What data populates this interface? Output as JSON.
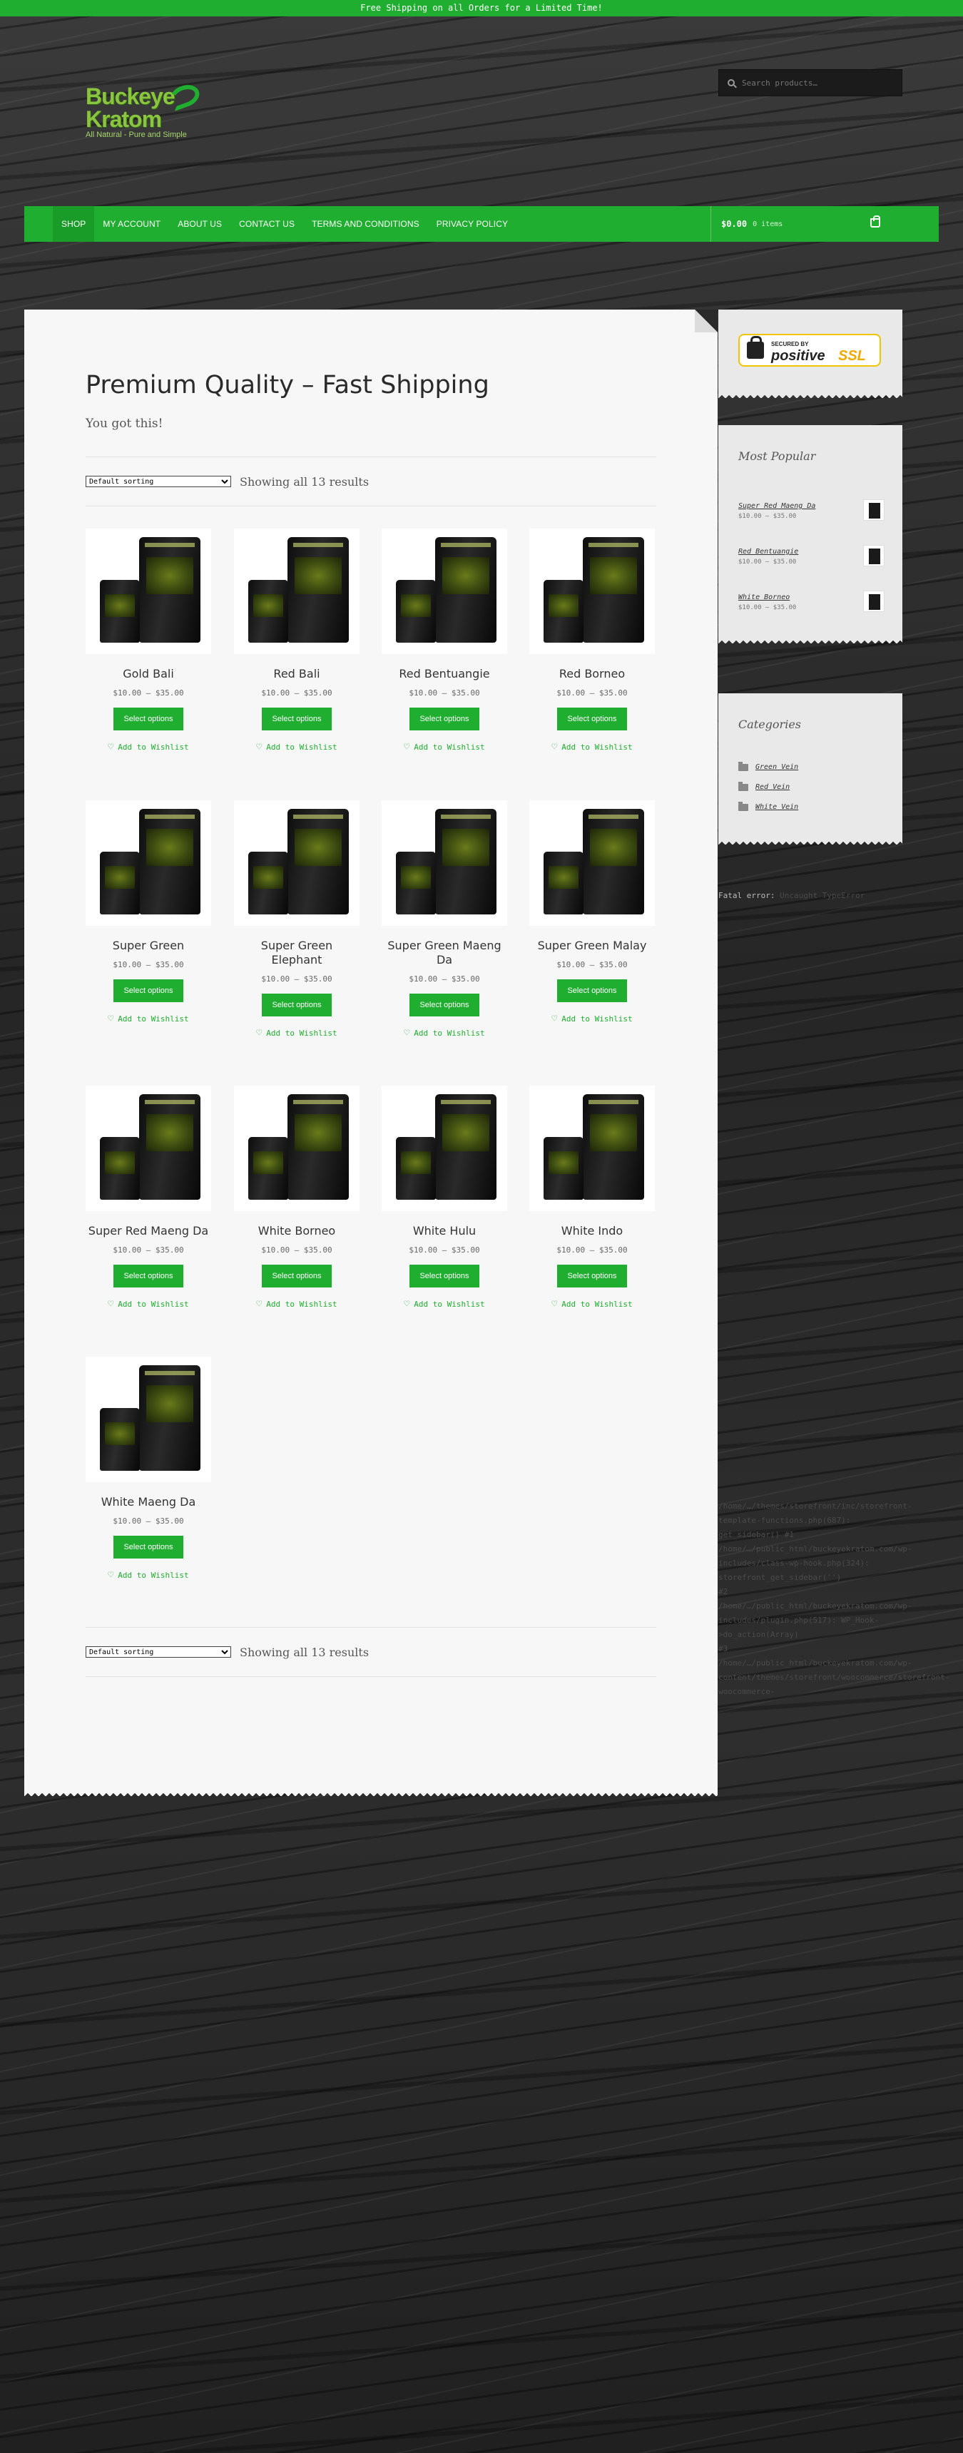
{
  "topbar": {
    "text": "Free Shipping on all Orders for a Limited Time!"
  },
  "logo": {
    "line1": "Buckeye",
    "line2": "Kratom",
    "tagline": "All Natural - Pure and Simple"
  },
  "search": {
    "placeholder": "Search products…"
  },
  "nav": {
    "items": [
      "SHOP",
      "MY ACCOUNT",
      "ABOUT US",
      "CONTACT US",
      "TERMS AND CONDITIONS",
      "PRIVACY POLICY"
    ],
    "cart_amount": "$0.00",
    "cart_count": "0 items"
  },
  "main": {
    "title": "Premium Quality – Fast Shipping",
    "subtitle": "You got this!",
    "sort_selected": "Default sorting",
    "results": "Showing all 13 results"
  },
  "product_button": "Select options",
  "wishlist_label": "Add to Wishlist",
  "products": [
    {
      "name": "Gold Bali",
      "price": "$10.00 – $35.00"
    },
    {
      "name": "Red Bali",
      "price": "$10.00 – $35.00"
    },
    {
      "name": "Red Bentuangie",
      "price": "$10.00 – $35.00"
    },
    {
      "name": "Red Borneo",
      "price": "$10.00 – $35.00"
    },
    {
      "name": "Super Green",
      "price": "$10.00 – $35.00"
    },
    {
      "name": "Super Green Elephant",
      "price": "$10.00 – $35.00"
    },
    {
      "name": "Super Green Maeng Da",
      "price": "$10.00 – $35.00"
    },
    {
      "name": "Super Green Malay",
      "price": "$10.00 – $35.00"
    },
    {
      "name": "Super Red Maeng Da",
      "price": "$10.00 – $35.00"
    },
    {
      "name": "White Borneo",
      "price": "$10.00 – $35.00"
    },
    {
      "name": "White Hulu",
      "price": "$10.00 – $35.00"
    },
    {
      "name": "White Indo",
      "price": "$10.00 – $35.00"
    },
    {
      "name": "White Maeng Da",
      "price": "$10.00 – $35.00"
    }
  ],
  "ssl_badge": {
    "secured_by": "SECURED BY",
    "brand": "positive",
    "brand_suffix": "SSL"
  },
  "most_popular": {
    "title": "Most Popular",
    "items": [
      {
        "name": "Super Red Maeng Da",
        "price": "$10.00 – $35.00"
      },
      {
        "name": "Red Bentuangie",
        "price": "$10.00 – $35.00"
      },
      {
        "name": "White Borneo",
        "price": "$10.00 – $35.00"
      }
    ]
  },
  "categories": {
    "title": "Categories",
    "items": [
      "Green Vein",
      "Red Vein",
      "White Vein"
    ]
  },
  "error_log": {
    "error_label": "Fatal error:",
    "error_text": "Uncaught TypeError",
    "trace": [
      "/home/…/themes/storefront/inc/storefront-template-functions.php(687):",
      "get_sidebar() #1",
      "/home/…/public_html/buckeyekratom.com/wp-includes/class-wp-hook.php(324):",
      "storefront_get_sidebar('')",
      "#2 /home/…/public_html/buckeyekratom.com/wp-includes/plugin.php(517): WP_Hook->do_action(Array)",
      "#3 /home/…/public_html/buckeyekratom.com/wp-content/themes/storefront/woocommerce/storefront-woocommerce-"
    ]
  }
}
